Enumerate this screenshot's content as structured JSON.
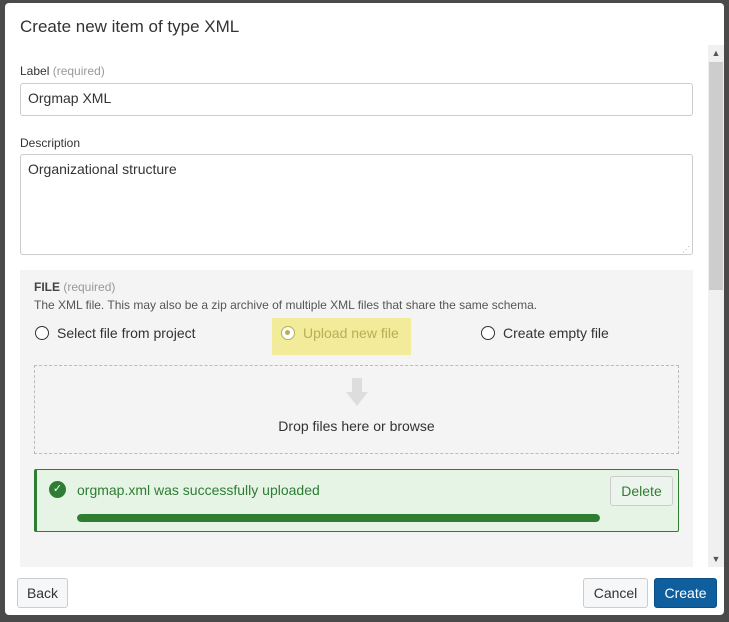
{
  "dialog": {
    "title": "Create new item of type XML"
  },
  "label_field": {
    "label": "Label",
    "required": "(required)",
    "value": "Orgmap XML"
  },
  "description_field": {
    "label": "Description",
    "value": "Organizational structure"
  },
  "file": {
    "label": "FILE",
    "required": "(required)",
    "help": "The XML file. This may also be a zip archive of multiple XML files that share the same schema.",
    "options": [
      {
        "label": "Select file from project",
        "selected": false
      },
      {
        "label": "Upload new file",
        "selected": true
      },
      {
        "label": "Create empty file",
        "selected": false
      }
    ],
    "drop_text": "Drop files here or browse",
    "upload": {
      "message": "orgmap.xml was successfully uploaded",
      "delete_label": "Delete",
      "progress_percent": 100,
      "color": "#2e7d32"
    }
  },
  "footer": {
    "back": "Back",
    "cancel": "Cancel",
    "create": "Create",
    "create_color": "#0f5f9e"
  }
}
